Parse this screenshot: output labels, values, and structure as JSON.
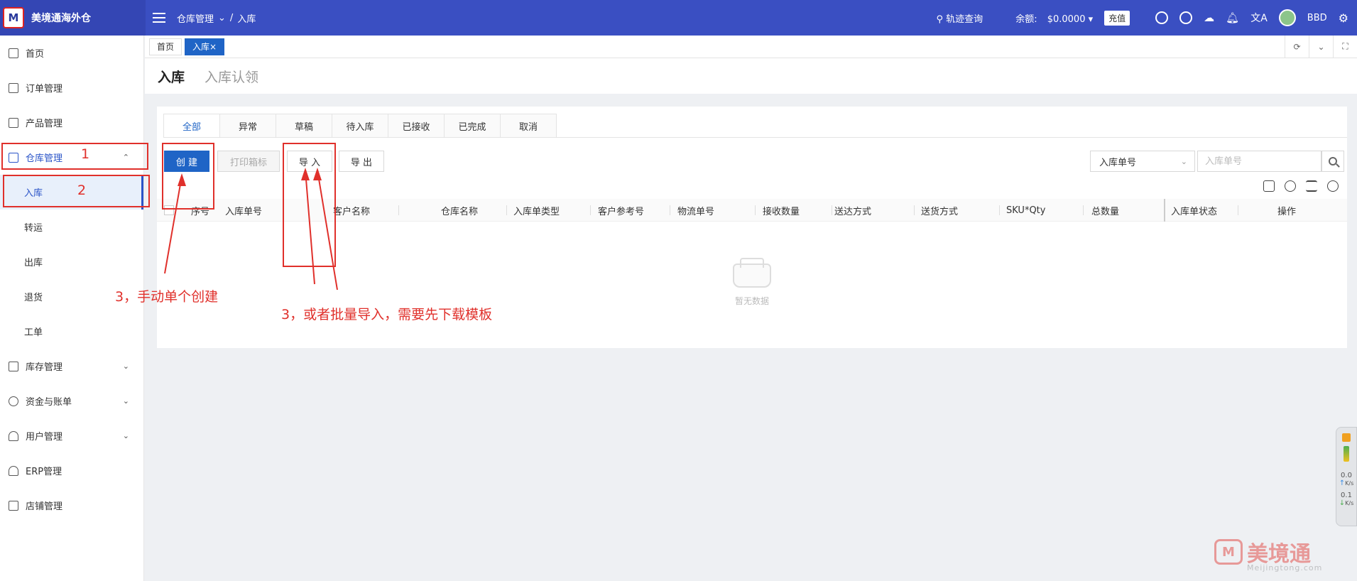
{
  "app": {
    "name": "美境通海外仓",
    "logo_text": "M"
  },
  "header": {
    "breadcrumb": [
      "仓库管理",
      "入库"
    ],
    "track_query": "轨迹查询",
    "balance_label": "余额:",
    "balance_value": "$0.0000",
    "recharge": "充值",
    "user": "BBD"
  },
  "sidebar": {
    "items": [
      {
        "label": "首页",
        "icon": "grid-icon"
      },
      {
        "label": "订单管理",
        "icon": "order-icon"
      },
      {
        "label": "产品管理",
        "icon": "product-icon"
      },
      {
        "label": "仓库管理",
        "icon": "warehouse-icon",
        "expanded": true
      },
      {
        "label": "库存管理",
        "icon": "inventory-icon"
      },
      {
        "label": "资金与账单",
        "icon": "finance-icon"
      },
      {
        "label": "用户管理",
        "icon": "user-icon"
      },
      {
        "label": "ERP管理",
        "icon": "erp-icon"
      },
      {
        "label": "店铺管理",
        "icon": "shop-icon"
      }
    ],
    "warehouse_sub": [
      "入库",
      "转运",
      "出库",
      "退货",
      "工单"
    ]
  },
  "page_tabs": [
    "首页",
    "入库"
  ],
  "page_tab_close": "×",
  "page": {
    "title": "入库",
    "subtitle": "入库认领"
  },
  "status_tabs": [
    "全部",
    "异常",
    "草稿",
    "待入库",
    "已接收",
    "已完成",
    "取消"
  ],
  "toolbar": {
    "create": "创 建",
    "print_label": "打印箱标",
    "import": "导 入",
    "export": "导 出"
  },
  "filter": {
    "field": "入库单号",
    "placeholder": "入库单号"
  },
  "table": {
    "columns": [
      "序号",
      "入库单号",
      "客户名称",
      "仓库名称",
      "入库单类型",
      "客户参考号",
      "物流单号",
      "接收数量",
      "送达方式",
      "送货方式",
      "SKU*Qty",
      "总数量",
      "入库单状态",
      "操作"
    ],
    "empty_text": "暂无数据"
  },
  "annotations": {
    "step1": "1",
    "step2": "2",
    "step3a": "3，手动单个创建",
    "step3b": "3，或者批量导入，需要先下载模板"
  },
  "widget": {
    "speed_up": "0.0",
    "speed_down": "0.1",
    "unit": "K/s"
  },
  "watermark": {
    "name": "美境通",
    "domain": "Meijingtong.com"
  }
}
